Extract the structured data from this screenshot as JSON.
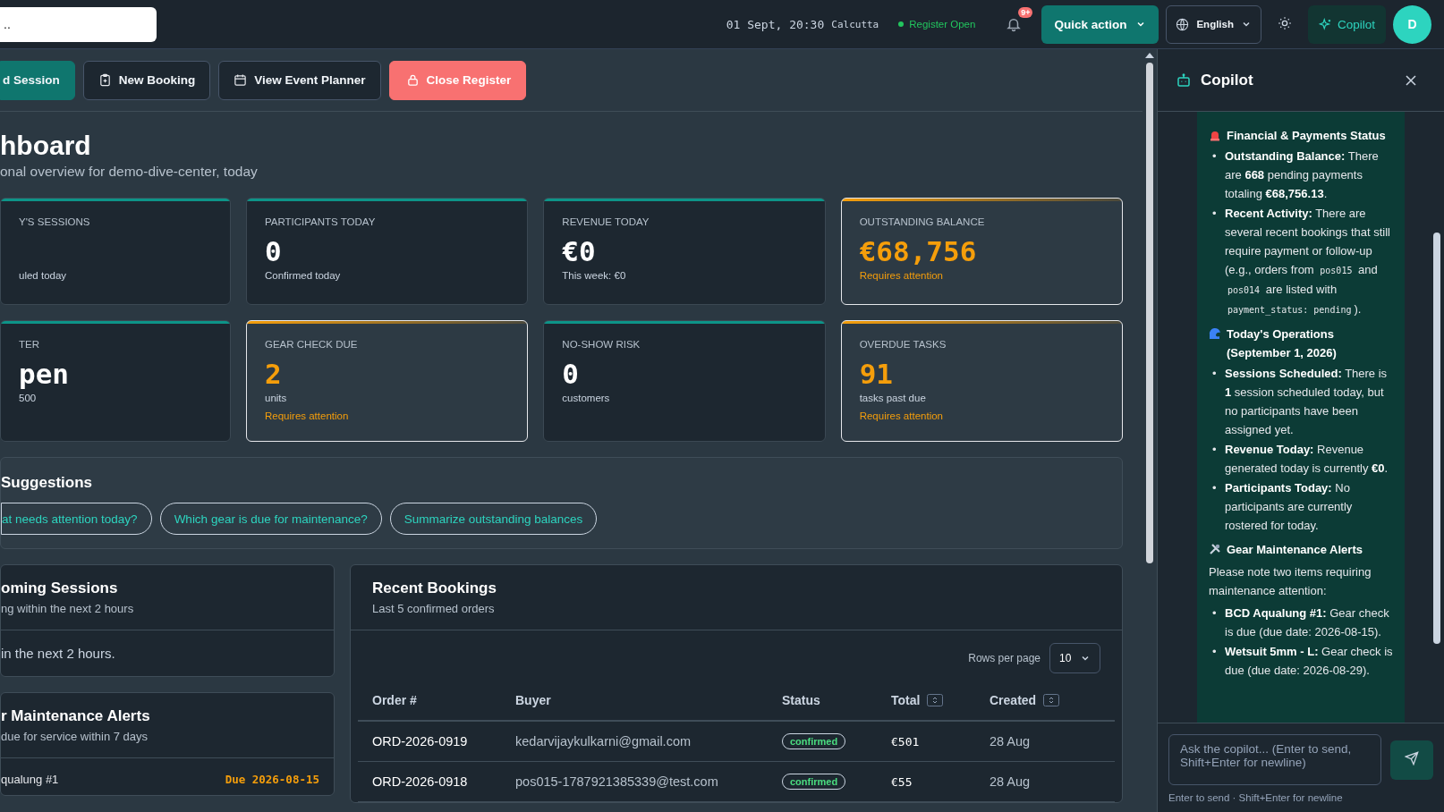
{
  "topbar": {
    "search_value": "..",
    "datetime": "01 Sept, 20:30",
    "timezone": "Calcutta",
    "register_status": "Register Open",
    "register_open": true,
    "notification_badge": "9+",
    "quick_action": "Quick action",
    "language": "English",
    "copilot_button": "Copilot",
    "avatar": "D"
  },
  "actions": [
    {
      "label": "d Session",
      "kind": "primary"
    },
    {
      "label": "New Booking",
      "kind": "booking"
    },
    {
      "label": "View Event Planner",
      "kind": "calendar"
    },
    {
      "label": "Close Register",
      "kind": "danger"
    }
  ],
  "page": {
    "title": "hboard",
    "subtitle": "onal overview for demo-dive-center, today"
  },
  "stats": [
    {
      "label": "Y'S SESSIONS",
      "note": "uled today",
      "kind": "normal"
    },
    {
      "label": "PARTICIPANTS TODAY",
      "value": "0",
      "note": "Confirmed today",
      "kind": "normal"
    },
    {
      "label": "REVENUE TODAY",
      "value": "€0",
      "note": "This week: €0",
      "kind": "normal"
    },
    {
      "label": "OUTSTANDING BALANCE",
      "value": "€68,756",
      "alert": "Requires attention",
      "kind": "warning"
    },
    {
      "label": "TER",
      "value": "pen",
      "note": "500",
      "kind": "normal"
    },
    {
      "label": "GEAR CHECK DUE",
      "value": "2",
      "note": "units",
      "alert": "Requires attention",
      "kind": "warning"
    },
    {
      "label": "NO-SHOW RISK",
      "value": "0",
      "note": "customers",
      "kind": "normal"
    },
    {
      "label": "OVERDUE TASKS",
      "value": "91",
      "note": "tasks past due",
      "alert": "Requires attention",
      "kind": "warning"
    }
  ],
  "suggestions": {
    "title": "Suggestions",
    "chips": [
      "at needs attention today?",
      "Which gear is due for maintenance?",
      "Summarize outstanding balances"
    ]
  },
  "upcoming": {
    "title": "oming Sessions",
    "subtitle": "ng within the next 2 hours",
    "empty": "in the next 2 hours."
  },
  "maintenance": {
    "title": "r Maintenance Alerts",
    "subtitle": "due for service within 7 days",
    "items": [
      {
        "name": "qualung #1",
        "due": "Due 2026-08-15"
      }
    ]
  },
  "bookings": {
    "title": "Recent Bookings",
    "subtitle": "Last 5 confirmed orders",
    "rows_per_page_label": "Rows per page",
    "rows_per_page": "10",
    "columns": [
      {
        "label": "Order #",
        "sortable": false
      },
      {
        "label": "Buyer",
        "sortable": false
      },
      {
        "label": "Status",
        "sortable": false
      },
      {
        "label": "Total",
        "sortable": true
      },
      {
        "label": "Created",
        "sortable": true
      }
    ],
    "rows": [
      {
        "order": "ORD-2026-0919",
        "buyer": "kedarvijaykulkarni@gmail.com",
        "status": "confirmed",
        "total": "€501",
        "created": "28 Aug"
      },
      {
        "order": "ORD-2026-0918",
        "buyer": "pos015-1787921385339@test.com",
        "status": "confirmed",
        "total": "€55",
        "created": "28 Aug"
      }
    ]
  },
  "copilot": {
    "title": "Copilot",
    "blocks": [
      {
        "kind": "heading",
        "text": "Financial & Payments Status"
      },
      {
        "kind": "bullets",
        "items": [
          {
            "marker": "•",
            "parts": [
              {
                "kind": "text",
                "text": "**Outstanding Balance:** There are **668** pending payments totaling **€68,756.13**."
              }
            ]
          },
          {
            "marker": "•",
            "parts": [
              {
                "kind": "text",
                "text": "**Recent Activity:** There are several recent bookings that still require payment or follow-up (e.g., orders from "
              },
              {
                "kind": "code",
                "text": "pos015"
              },
              {
                "kind": "text",
                "text": " and "
              },
              {
                "kind": "code",
                "text": "pos014"
              },
              {
                "kind": "text",
                "text": " are listed with "
              },
              {
                "kind": "code",
                "text": "payment_status: pending"
              },
              {
                "kind": "text",
                "text": ")."
              }
            ]
          }
        ]
      },
      {
        "kind": "heading",
        "text": "Today's Operations (September 1, 2026)"
      },
      {
        "kind": "bullets",
        "items": [
          {
            "marker": "•",
            "parts": [
              {
                "kind": "text",
                "text": "**Sessions Scheduled:** There is **1** session scheduled today, but no participants have been assigned yet."
              }
            ]
          },
          {
            "marker": "•",
            "parts": [
              {
                "kind": "text",
                "text": "**Revenue Today:** Revenue generated today is currently **€0**."
              }
            ]
          },
          {
            "marker": "•",
            "parts": [
              {
                "kind": "text",
                "text": "**Participants Today:** No participants are currently rostered for today."
              }
            ]
          }
        ]
      },
      {
        "kind": "heading",
        "text": "Gear Maintenance Alerts"
      },
      {
        "kind": "paragraph",
        "text": "Please note two items requiring maintenance attention:"
      },
      {
        "kind": "bullets",
        "items": [
          {
            "marker": "•",
            "parts": [
              {
                "kind": "text",
                "text": "**BCD Aqualung #1:** Gear check is due (due date: 2026-08-15)."
              }
            ]
          },
          {
            "marker": "•",
            "parts": [
              {
                "kind": "text",
                "text": "**Wetsuit 5mm - L:** Gear check is due (due date: 2026-08-29)."
              }
            ]
          }
        ]
      }
    ],
    "input_placeholder": "Ask the copilot... (Enter to send, Shift+Enter for newline)",
    "hint": "Enter to send · Shift+Enter for newline"
  }
}
